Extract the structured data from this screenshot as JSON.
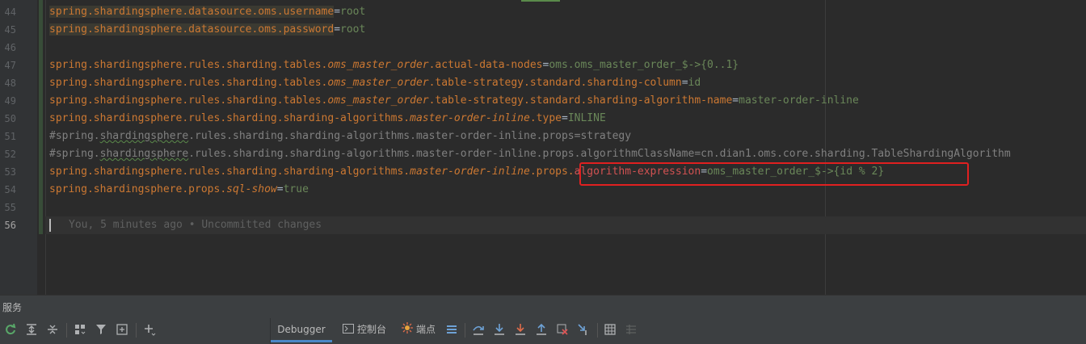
{
  "editor": {
    "lines": [
      {
        "n": "44",
        "parts": [
          {
            "t": "spring.shardingsphere.datasource.oms.username",
            "c": "k hl"
          },
          {
            "t": "=",
            "c": "eq"
          },
          {
            "t": "root",
            "c": "v"
          }
        ]
      },
      {
        "n": "45",
        "parts": [
          {
            "t": "spring.shardingsphere.datasource.oms.password",
            "c": "k hl"
          },
          {
            "t": "=",
            "c": "eq"
          },
          {
            "t": "root",
            "c": "v"
          }
        ]
      },
      {
        "n": "46",
        "parts": []
      },
      {
        "n": "47",
        "parts": [
          {
            "t": "spring.shardingsphere.rules.sharding.tables.",
            "c": "k"
          },
          {
            "t": "oms_master_order",
            "c": "ki"
          },
          {
            "t": ".actual-data-nodes",
            "c": "k"
          },
          {
            "t": "=",
            "c": "eq"
          },
          {
            "t": "oms.oms_master_order_$->{0..1}",
            "c": "v"
          }
        ]
      },
      {
        "n": "48",
        "parts": [
          {
            "t": "spring.shardingsphere.rules.sharding.tables.",
            "c": "k"
          },
          {
            "t": "oms_master_order",
            "c": "ki"
          },
          {
            "t": ".table-strategy.standard.sharding-column",
            "c": "k"
          },
          {
            "t": "=",
            "c": "eq"
          },
          {
            "t": "id",
            "c": "v"
          }
        ]
      },
      {
        "n": "49",
        "parts": [
          {
            "t": "spring.shardingsphere.rules.sharding.tables.",
            "c": "k"
          },
          {
            "t": "oms_master_order",
            "c": "ki"
          },
          {
            "t": ".table-strategy.standard.sharding-algorithm-name",
            "c": "k"
          },
          {
            "t": "=",
            "c": "eq"
          },
          {
            "t": "master-order-inline",
            "c": "v"
          }
        ]
      },
      {
        "n": "50",
        "parts": [
          {
            "t": "spring.shardingsphere.rules.sharding.sharding-algorithms.",
            "c": "k"
          },
          {
            "t": "master-order-inline",
            "c": "ki"
          },
          {
            "t": ".type",
            "c": "k"
          },
          {
            "t": "=",
            "c": "eq"
          },
          {
            "t": "INLINE",
            "c": "v"
          }
        ]
      },
      {
        "n": "51",
        "parts": [
          {
            "t": "#spring.",
            "c": "c"
          },
          {
            "t": "shardingsphere",
            "c": "c sq"
          },
          {
            "t": ".rules.sharding.sharding-algorithms.master-order-inline.props=strategy",
            "c": "c"
          }
        ]
      },
      {
        "n": "52",
        "parts": [
          {
            "t": "#spring.",
            "c": "c"
          },
          {
            "t": "shardingsphere",
            "c": "c sq"
          },
          {
            "t": ".rules.sharding.sharding-algorithms.master-order-inline.props.algorithmClassName=cn.dian1.oms.core.sharding.TableShardingAlgorithm",
            "c": "c"
          }
        ]
      },
      {
        "n": "53",
        "parts": [
          {
            "t": "spring.shardingsphere.rules.sharding.sharding-algorithms.",
            "c": "k"
          },
          {
            "t": "master-order-inline",
            "c": "ki"
          },
          {
            "t": ".props.",
            "c": "k"
          },
          {
            "t": "algorithm-expression",
            "c": "red"
          },
          {
            "t": "=",
            "c": "eq"
          },
          {
            "t": "oms_master_order_$->{id % 2}",
            "c": "v"
          }
        ]
      },
      {
        "n": "54",
        "parts": [
          {
            "t": "spring.shardingsphere.props.",
            "c": "k"
          },
          {
            "t": "sql-show",
            "c": "ki"
          },
          {
            "t": "=",
            "c": "eq"
          },
          {
            "t": "true",
            "c": "v"
          }
        ]
      },
      {
        "n": "55",
        "parts": []
      },
      {
        "n": "56",
        "parts": []
      }
    ],
    "blame": "You, 5 minutes ago • Uncommitted changes"
  },
  "services": {
    "title": "服务",
    "tabs": [
      {
        "label": "Debugger",
        "name": "tab-debugger"
      },
      {
        "label": "控制台",
        "name": "tab-console"
      },
      {
        "label": "端点",
        "name": "tab-endpoints"
      }
    ]
  },
  "colors": {
    "accent": "#4a88c7",
    "highlight_box": "#e02020"
  }
}
